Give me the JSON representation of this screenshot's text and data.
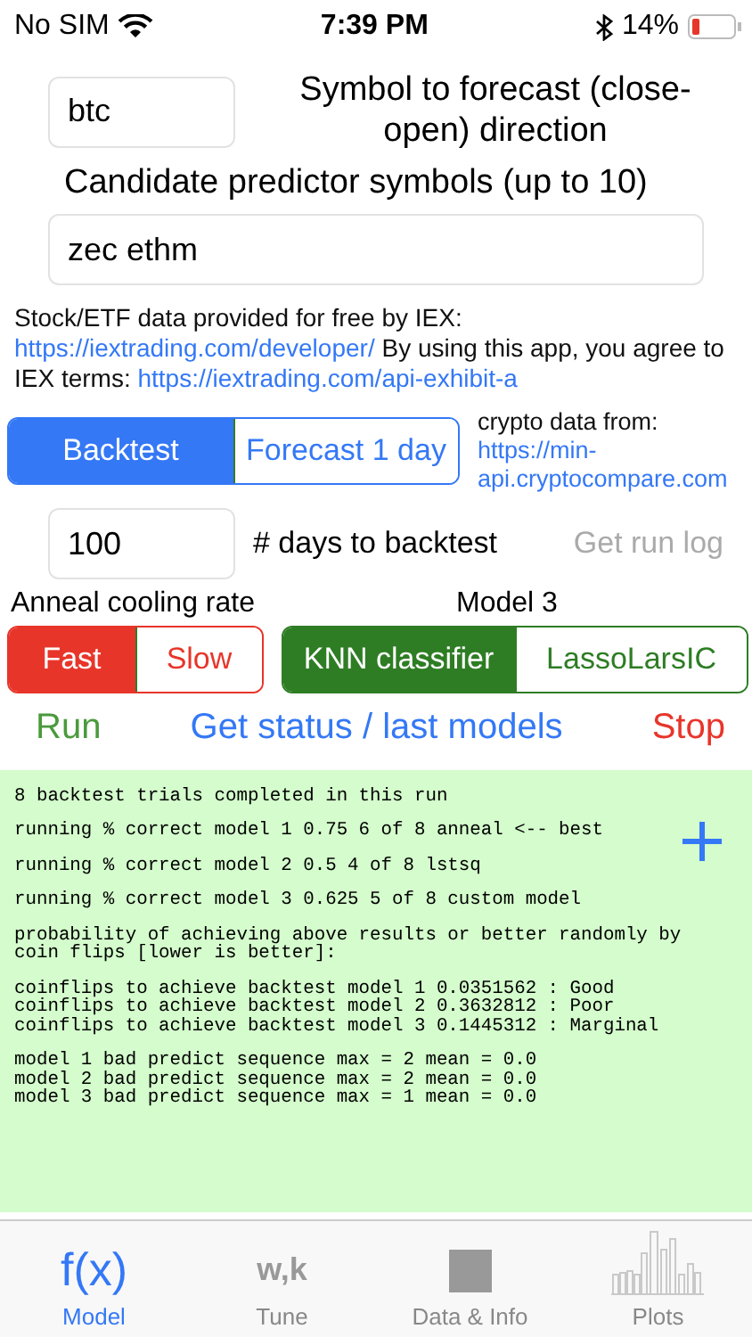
{
  "status_bar": {
    "carrier": "No SIM",
    "time": "7:39 PM",
    "battery": "14%"
  },
  "symbol_field": {
    "value": "btc"
  },
  "symbol_label": "Symbol to forecast (close-open) direction",
  "candidates_label": "Candidate predictor symbols (up to 10)",
  "candidates_field": {
    "value": "zec ethm"
  },
  "iex_notice": [
    {
      "kind": "text",
      "text": "Stock/ETF data provided for free by IEX: "
    },
    {
      "kind": "link",
      "text": "https://iextrading.com/"
    },
    {
      "kind": "link",
      "text": "developer/"
    },
    {
      "kind": "text",
      "text": " By using this app, you agree to IEX terms: "
    },
    {
      "kind": "link",
      "text": "https://"
    },
    {
      "kind": "link",
      "text": "iextrading.com/api-exhibit-a"
    }
  ],
  "mode_segments": [
    {
      "label": "Backtest",
      "selected": true
    },
    {
      "label": "Forecast 1 day",
      "selected": false
    }
  ],
  "crypto_label": "crypto data from:",
  "crypto_links": [
    "https://min-",
    "api.cryptocompare.com"
  ],
  "days_field": {
    "value": "100"
  },
  "days_label": "# days to backtest",
  "run_log_button": {
    "label": "Get run log",
    "disabled": true
  },
  "anneal_label": "Anneal cooling rate",
  "anneal_segments": [
    {
      "label": "Fast",
      "selected": true
    },
    {
      "label": "Slow",
      "selected": false
    }
  ],
  "model3_label": "Model 3",
  "model3_segments": [
    {
      "label": "KNN classifier",
      "selected": true
    },
    {
      "label": "LassoLarsIC",
      "selected": false
    }
  ],
  "actions": [
    {
      "label": "Run",
      "color": "#4a9a3c"
    },
    {
      "label": "Get status / last models",
      "color": "#3478f6"
    },
    {
      "label": "Stop",
      "color": "#e8352a"
    }
  ],
  "log": [
    [
      "8 backtest trials completed in this run"
    ],
    [
      "running % correct model 1 0.75 6 of 8 anneal <-- best"
    ],
    [
      "running % correct model 2 0.5 4 of 8 lstsq"
    ],
    [
      "running % correct model 3 0.625 5 of 8 custom model"
    ],
    [
      "probability of achieving above results or better randomly by",
      "coin flips [lower is better]:"
    ],
    [
      "coinflips to achieve backtest model 1 0.0351562 : Good",
      "coinflips to achieve backtest model 2 0.3632812 : Poor",
      "coinflips to achieve backtest model 3 0.1445312 : Marginal"
    ],
    [
      "model 1 bad predict sequence max = 2 mean = 0.0",
      "model 2 bad predict sequence max = 2 mean = 0.0",
      "model 3 bad predict sequence max = 1 mean = 0.0"
    ]
  ],
  "tabs": [
    {
      "label": "Model",
      "kind": "glyph",
      "glyph": "f(x)",
      "selected": true
    },
    {
      "label": "Tune",
      "kind": "glyph",
      "glyph": "w,k",
      "selected": false
    },
    {
      "label": "Data & Info",
      "kind": "square",
      "selected": false
    },
    {
      "label": "Plots",
      "kind": "bars",
      "selected": false
    }
  ]
}
